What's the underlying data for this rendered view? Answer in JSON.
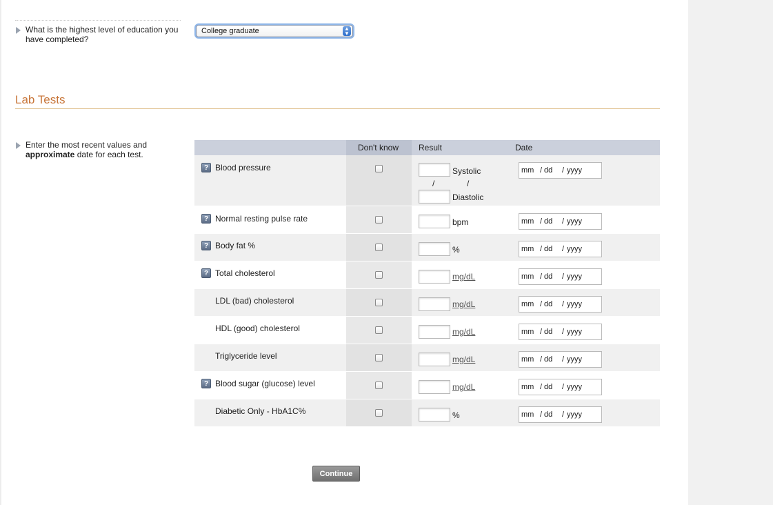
{
  "education": {
    "question": "What is the highest level of education you have completed?",
    "selected": "College graduate"
  },
  "lab_tests": {
    "title": "Lab Tests",
    "instruction_pre": "Enter the most recent values and ",
    "instruction_bold": "approximate",
    "instruction_post": " date for each test.",
    "headers": {
      "dont_know": "Don't know",
      "result": "Result",
      "date": "Date"
    },
    "date_placeholder": {
      "mm": "mm",
      "dd": "dd",
      "yyyy": "yyyy",
      "sep": "/"
    },
    "rows": [
      {
        "label": "Blood pressure",
        "unit_top": "Systolic",
        "unit_bottom": "Diastolic",
        "slash": "/"
      },
      {
        "label": "Normal resting pulse rate",
        "unit": "bpm"
      },
      {
        "label": "Body fat %",
        "unit": "%"
      },
      {
        "label": "Total cholesterol",
        "unit": "mg/dL"
      },
      {
        "label": "LDL (bad) cholesterol",
        "unit": "mg/dL"
      },
      {
        "label": "HDL (good) cholesterol",
        "unit": "mg/dL"
      },
      {
        "label": "Triglyceride level",
        "unit": "mg/dL"
      },
      {
        "label": "Blood sugar (glucose) level",
        "unit": "mg/dL"
      },
      {
        "label": "Diabetic Only - HbA1C%",
        "unit": "%"
      }
    ],
    "help_icon_text": "?"
  },
  "continue_label": "Continue"
}
